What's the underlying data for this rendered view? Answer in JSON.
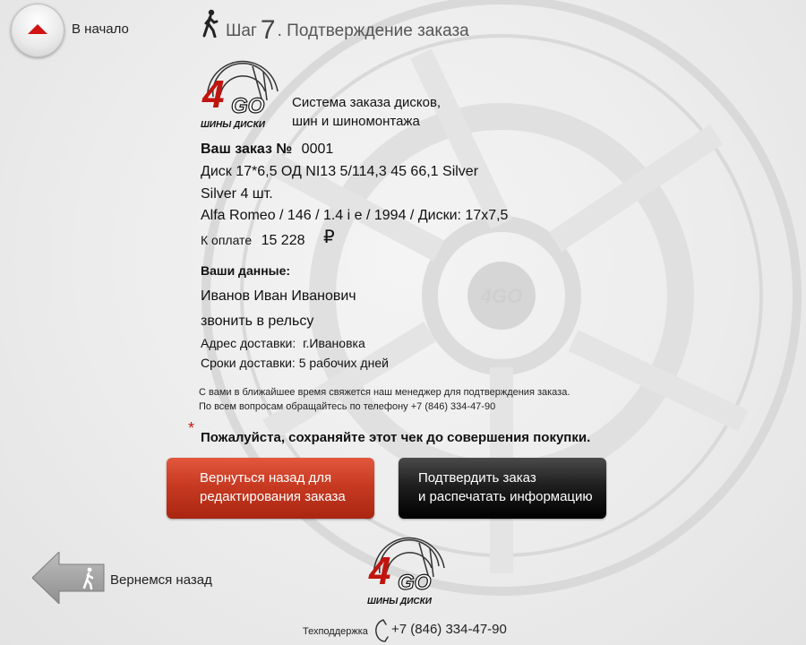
{
  "nav": {
    "home_label": "В начало",
    "back_label": "Вернемся назад"
  },
  "step": {
    "prefix": "Шаг",
    "number": "7",
    "title": ". Подтверждение заказа"
  },
  "brand": {
    "logo_text": "ШИНЫ ДИСКИ",
    "system_line1": "Система заказа дисков,",
    "system_line2": "шин и шиномонтажа"
  },
  "order": {
    "label": "Ваш заказ №",
    "number": "0001",
    "item_line1": "Диск 17*6,5 ОД NI13 5/114,3 45 66,1 Silver",
    "item_line2": "Silver 4 шт.",
    "car_line": "Alfa Romeo / 146 / 1.4 i e / 1994 / Диски: 17x7,5",
    "pay_label": "К оплате",
    "pay_amount": "15 228",
    "currency": "₽"
  },
  "customer": {
    "heading": "Ваши данные:",
    "name": "Иванов Иван Иванович",
    "contact": "звонить в рельсу",
    "address_label": "Адрес доставки:",
    "address_value": "г.Ивановка",
    "delivery_label": "Сроки доставки:",
    "delivery_value": "5 рабочих дней"
  },
  "notice": {
    "line1": "С вами в ближайшее время свяжется наш менеджер для подтверждения заказа.",
    "line2": "По всем вопросам обращайтесь по телефону +7 (846) 334-47-90",
    "asterisk": "*",
    "keep_check": "Пожалуйста, сохраняйте этот чек до совершения покупки."
  },
  "buttons": {
    "back_line1": "Вернуться назад для",
    "back_line2": "редактирования заказа",
    "confirm_line1": "Подтвердить заказ",
    "confirm_line2": "и распечатать информацию"
  },
  "support": {
    "label": "Техподдержка",
    "phone": "+7 (846) 334-47-90"
  },
  "colors": {
    "accent_red": "#c83a22",
    "dark_button": "#1f1f1f",
    "home_arrow": "#d01414"
  }
}
